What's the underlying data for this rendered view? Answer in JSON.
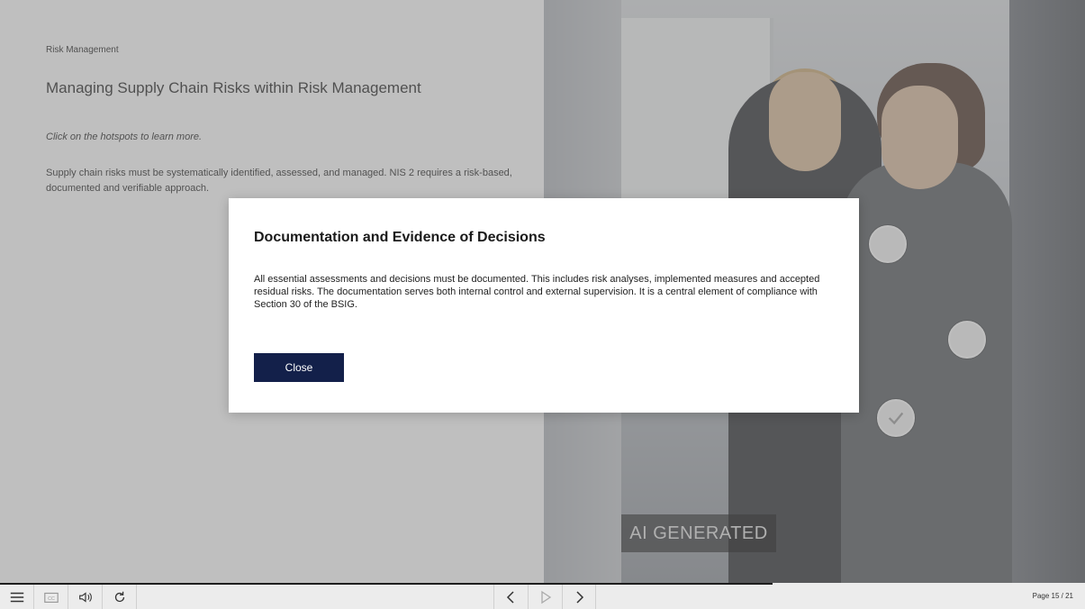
{
  "slide": {
    "breadcrumb": "Risk Management",
    "title": "Managing Supply Chain Risks within Risk Management",
    "instruction": "Click on the hotspots to learn more.",
    "body": "Supply chain risks must be systematically identified, assessed, and managed. NIS 2 requires a risk-based, documented and verifiable approach."
  },
  "image": {
    "badge": "AI GENERATED",
    "hotspots": [
      {
        "state": "unvisited"
      },
      {
        "state": "unvisited"
      },
      {
        "state": "visited"
      }
    ]
  },
  "modal": {
    "title": "Documentation and Evidence of Decisions",
    "body": "All essential assessments and decisions must be documented. This includes risk analyses, implemented measures and accepted residual risks. The documentation serves both internal control and external supervision. It is a central element of compliance with Section 30 of the BSIG.",
    "close_label": "Close"
  },
  "toolbar": {
    "menu_icon": "hamburger-menu-icon",
    "cc_label": "CC",
    "audio_icon": "speaker-icon",
    "replay_icon": "replay-icon",
    "prev_icon": "chevron-left-icon",
    "play_icon": "play-icon",
    "next_icon": "chevron-right-icon",
    "page_label": "Page 15 / 21"
  },
  "colors": {
    "modal_button": "#13204a",
    "overlay": "rgba(128,128,128,0.5)",
    "toolbar_bg": "#ececec"
  }
}
